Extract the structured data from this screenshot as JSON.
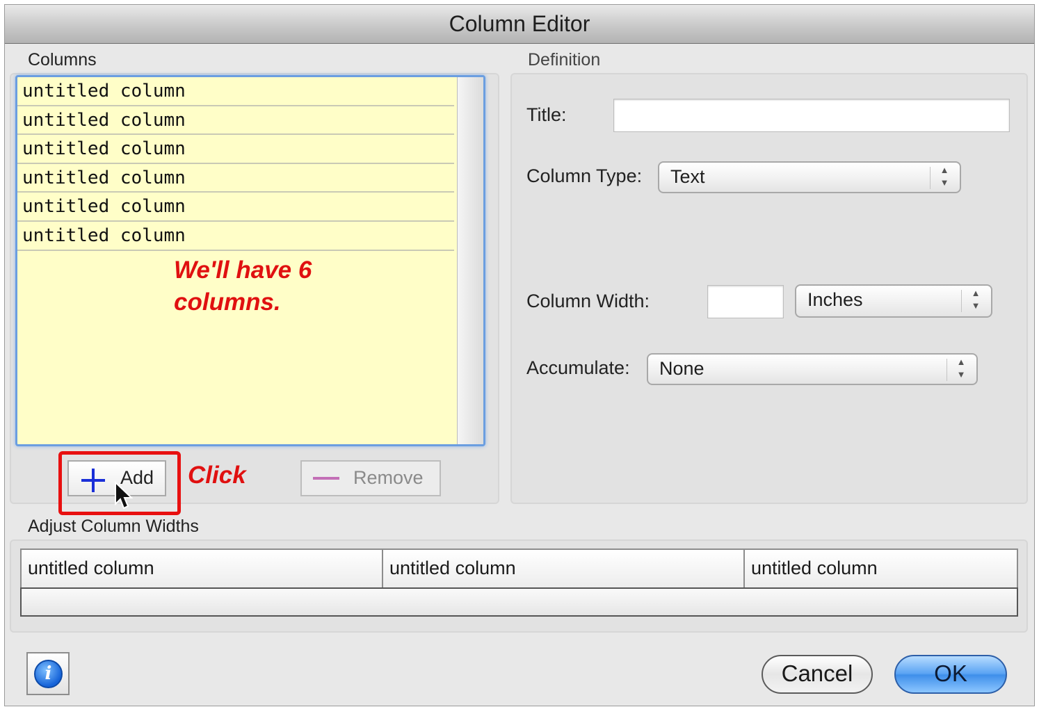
{
  "window": {
    "title": "Column Editor"
  },
  "columns_panel": {
    "label": "Columns",
    "items": [
      "untitled column",
      "untitled column",
      "untitled column",
      "untitled column",
      "untitled column",
      "untitled column"
    ],
    "note_line1": "We'll have 6",
    "note_line2": "columns.",
    "add_label": "Add",
    "remove_label": "Remove",
    "click_note": "Click"
  },
  "definition": {
    "label": "Definition",
    "title_label": "Title:",
    "title_value": "",
    "column_type_label": "Column Type:",
    "column_type_value": "Text",
    "column_width_label": "Column Width:",
    "column_width_value": "",
    "width_unit_value": "Inches",
    "accumulate_label": "Accumulate:",
    "accumulate_value": "None"
  },
  "adjust_widths": {
    "label": "Adjust Column Widths",
    "headers": [
      "untitled column",
      "untitled column",
      "untitled column"
    ]
  },
  "footer": {
    "info_glyph": "i",
    "cancel_label": "Cancel",
    "ok_label": "OK"
  },
  "colors": {
    "accent": "#3f8fea",
    "annotation": "#e01010",
    "list_background": "#fffec8"
  }
}
